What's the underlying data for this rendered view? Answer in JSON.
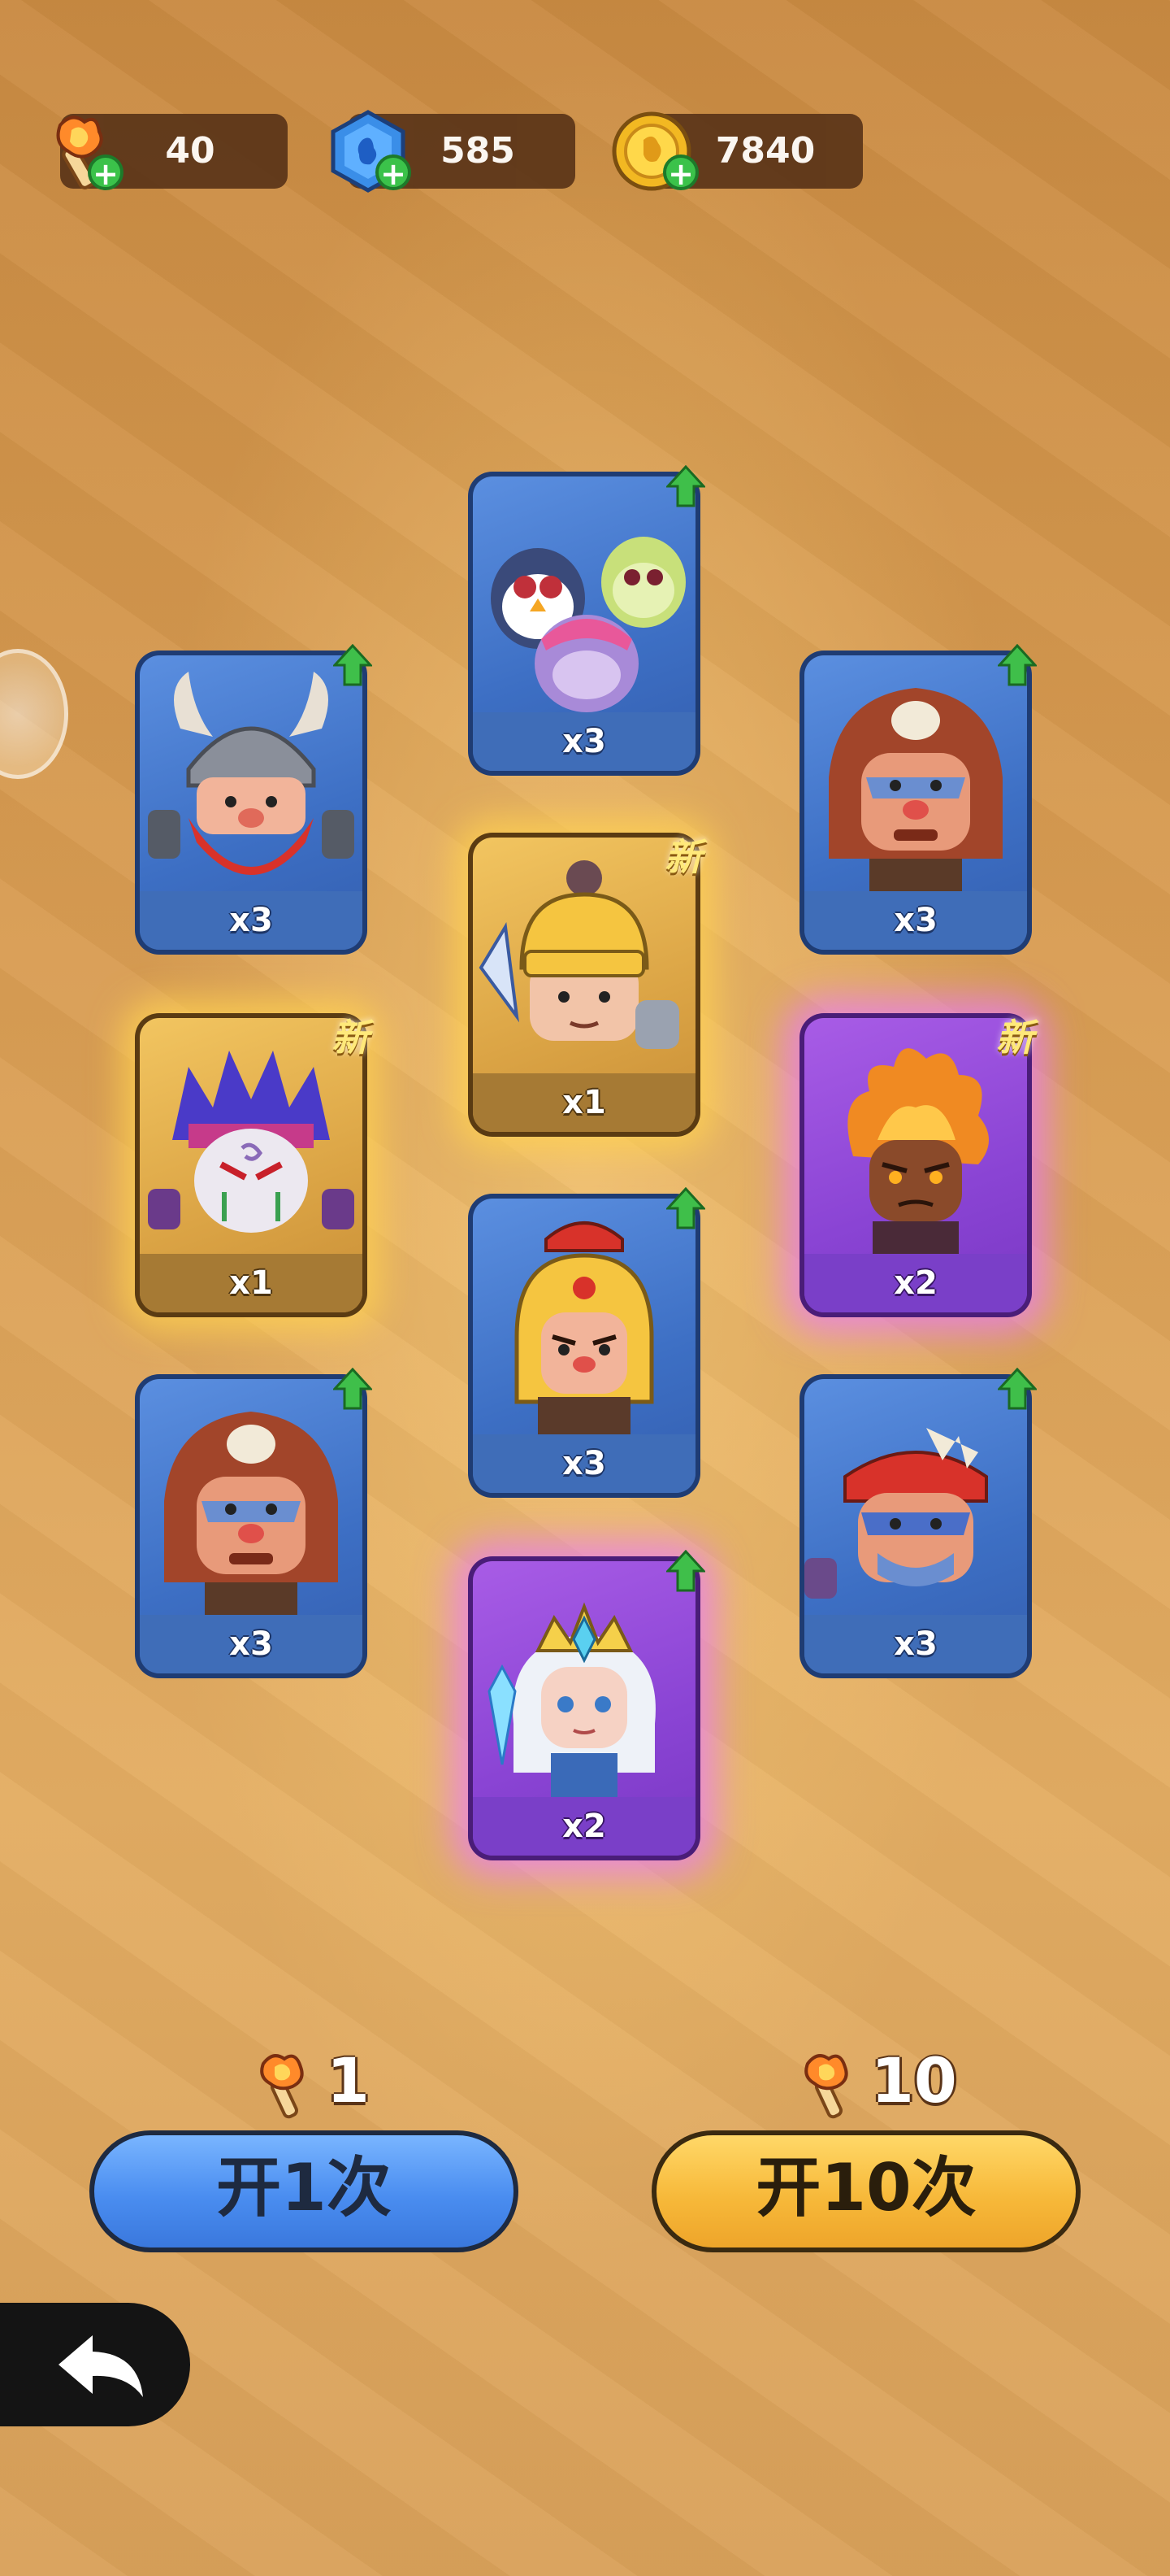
{
  "resources": {
    "torch": "40",
    "gem": "585",
    "coin": "7840"
  },
  "cards": [
    {
      "label": "x3",
      "new": ""
    },
    {
      "label": "x3",
      "new": ""
    },
    {
      "label": "x3",
      "new": ""
    },
    {
      "label": "x1",
      "new": "新"
    },
    {
      "label": "x1",
      "new": "新"
    },
    {
      "label": "x2",
      "new": "新"
    },
    {
      "label": "x3",
      "new": ""
    },
    {
      "label": "x3",
      "new": ""
    },
    {
      "label": "x3",
      "new": ""
    },
    {
      "label": "x2",
      "new": ""
    }
  ],
  "draw_single": {
    "cost": "1",
    "label": "开1次"
  },
  "draw_ten": {
    "cost": "10",
    "label": "开10次"
  },
  "colors": {
    "common_card": "#4a7bd0",
    "rare_card": "#e0a845",
    "epic_card": "#9a4fe0"
  }
}
